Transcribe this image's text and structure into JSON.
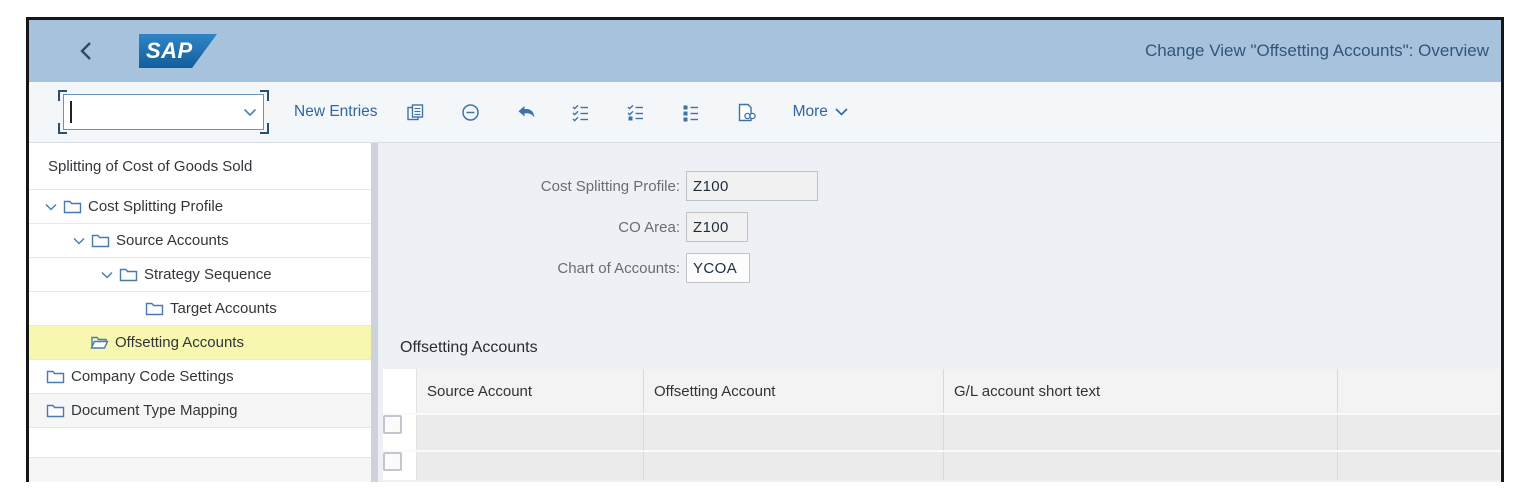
{
  "header": {
    "logo_text": "SAP",
    "title": "Change View \"Offsetting Accounts\": Overview"
  },
  "toolbar": {
    "command_field": {
      "value": "",
      "placeholder": ""
    },
    "new_entries_label": "New Entries",
    "more_label": "More",
    "icon_buttons": [
      "copy-icon",
      "delete-icon",
      "undo-icon",
      "select-all-icon",
      "select-block-icon",
      "deselect-all-icon",
      "find-icon"
    ]
  },
  "tree": {
    "items": [
      {
        "label": "Splitting of Cost of Goods Sold",
        "icon": null,
        "expanded": null,
        "selected": false
      },
      {
        "label": "Cost Splitting Profile",
        "icon": "folder-closed",
        "expanded": true,
        "selected": false
      },
      {
        "label": "Source Accounts",
        "icon": "folder-closed",
        "expanded": true,
        "selected": false
      },
      {
        "label": "Strategy Sequence",
        "icon": "folder-closed",
        "expanded": true,
        "selected": false
      },
      {
        "label": "Target Accounts",
        "icon": "folder-closed",
        "expanded": null,
        "selected": false
      },
      {
        "label": "Offsetting Accounts",
        "icon": "folder-open",
        "expanded": null,
        "selected": true
      },
      {
        "label": "Company Code Settings",
        "icon": "folder-closed",
        "expanded": null,
        "selected": false
      },
      {
        "label": "Document Type Mapping",
        "icon": "folder-closed",
        "expanded": null,
        "selected": false
      }
    ]
  },
  "form": {
    "fields": [
      {
        "label": "Cost Splitting Profile:",
        "value": "Z100"
      },
      {
        "label": "CO Area:",
        "value": "Z100"
      },
      {
        "label": "Chart of Accounts:",
        "value": "YCOA"
      }
    ]
  },
  "section": {
    "title": "Offsetting Accounts"
  },
  "table": {
    "columns": [
      "Source Account",
      "Offsetting Account",
      "G/L account short text",
      ""
    ],
    "rows": [
      {
        "checked": false
      },
      {
        "checked": false
      }
    ]
  },
  "colors": {
    "header_bar": "#a7c2dc",
    "logo_blue": "#135d9b",
    "icon_blue": "#30669c",
    "selection_yellow": "#f7f7b0",
    "content_bg": "#edf1f5"
  }
}
